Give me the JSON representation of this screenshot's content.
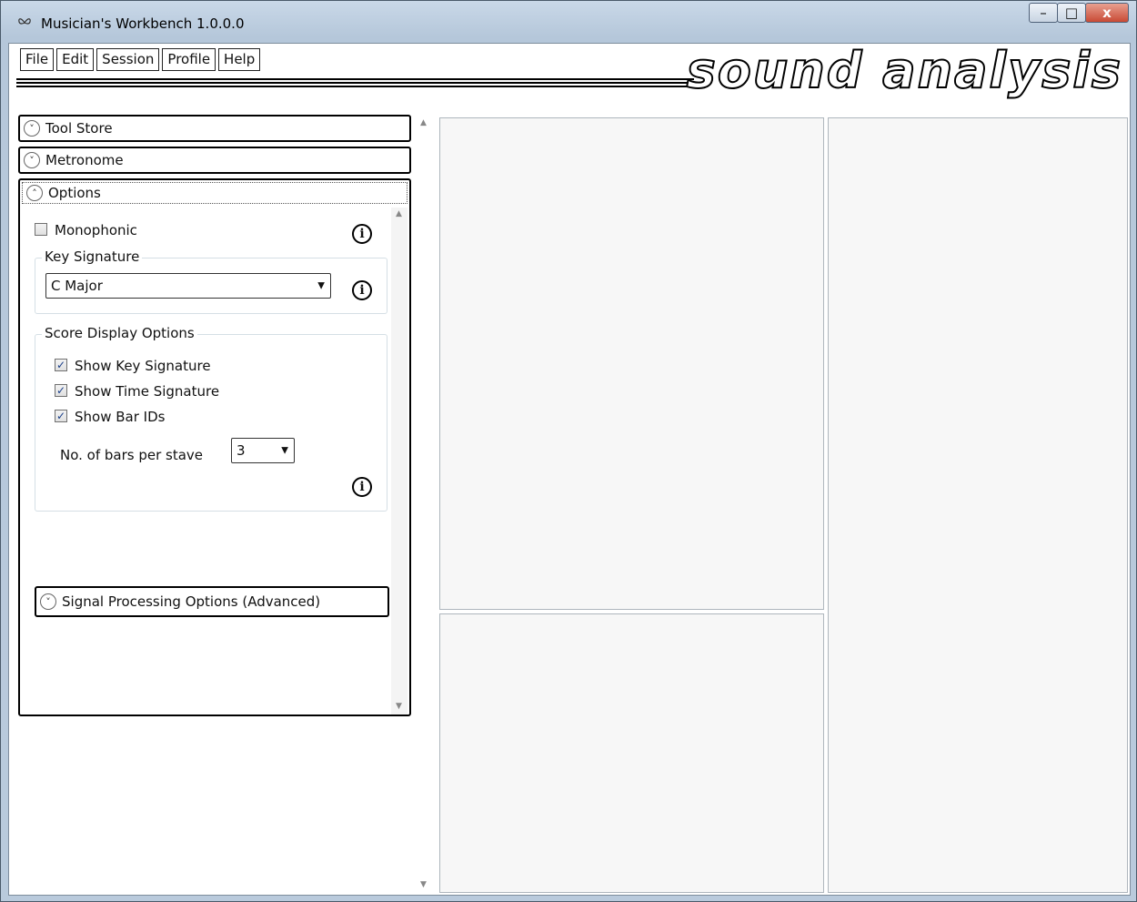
{
  "window": {
    "title": "Musician's Workbench 1.0.0.0",
    "minimize": "–",
    "maximize": "□",
    "close": "x"
  },
  "menu": {
    "items": [
      "File",
      "Edit",
      "Session",
      "Profile",
      "Help"
    ]
  },
  "logo": {
    "text": "sound analysis"
  },
  "panels": {
    "tool_store": {
      "label": "Tool Store",
      "expanded": false
    },
    "metronome": {
      "label": "Metronome",
      "expanded": false
    },
    "options": {
      "label": "Options",
      "expanded": true,
      "monophonic": {
        "label": "Monophonic",
        "checked": false
      },
      "key_signature": {
        "group_title": "Key Signature",
        "selected": "C Major"
      },
      "score_display": {
        "group_title": "Score Display Options",
        "show_key_signature": {
          "label": "Show Key Signature",
          "checked": true
        },
        "show_time_signature": {
          "label": "Show Time Signature",
          "checked": true
        },
        "show_bar_ids": {
          "label": "Show Bar IDs",
          "checked": true
        },
        "bars_per_stave": {
          "label": "No. of bars per stave",
          "selected": "3"
        }
      },
      "signal_processing": {
        "label": "Signal Processing Options (Advanced)",
        "expanded": false
      }
    }
  },
  "icons": {
    "app": "butterfly-icon",
    "chevron_down": "˅",
    "chevron_up": "˄",
    "info": "i",
    "dropdown": "▼",
    "check": "✓",
    "scroll_up": "▲",
    "scroll_down": "▼"
  }
}
